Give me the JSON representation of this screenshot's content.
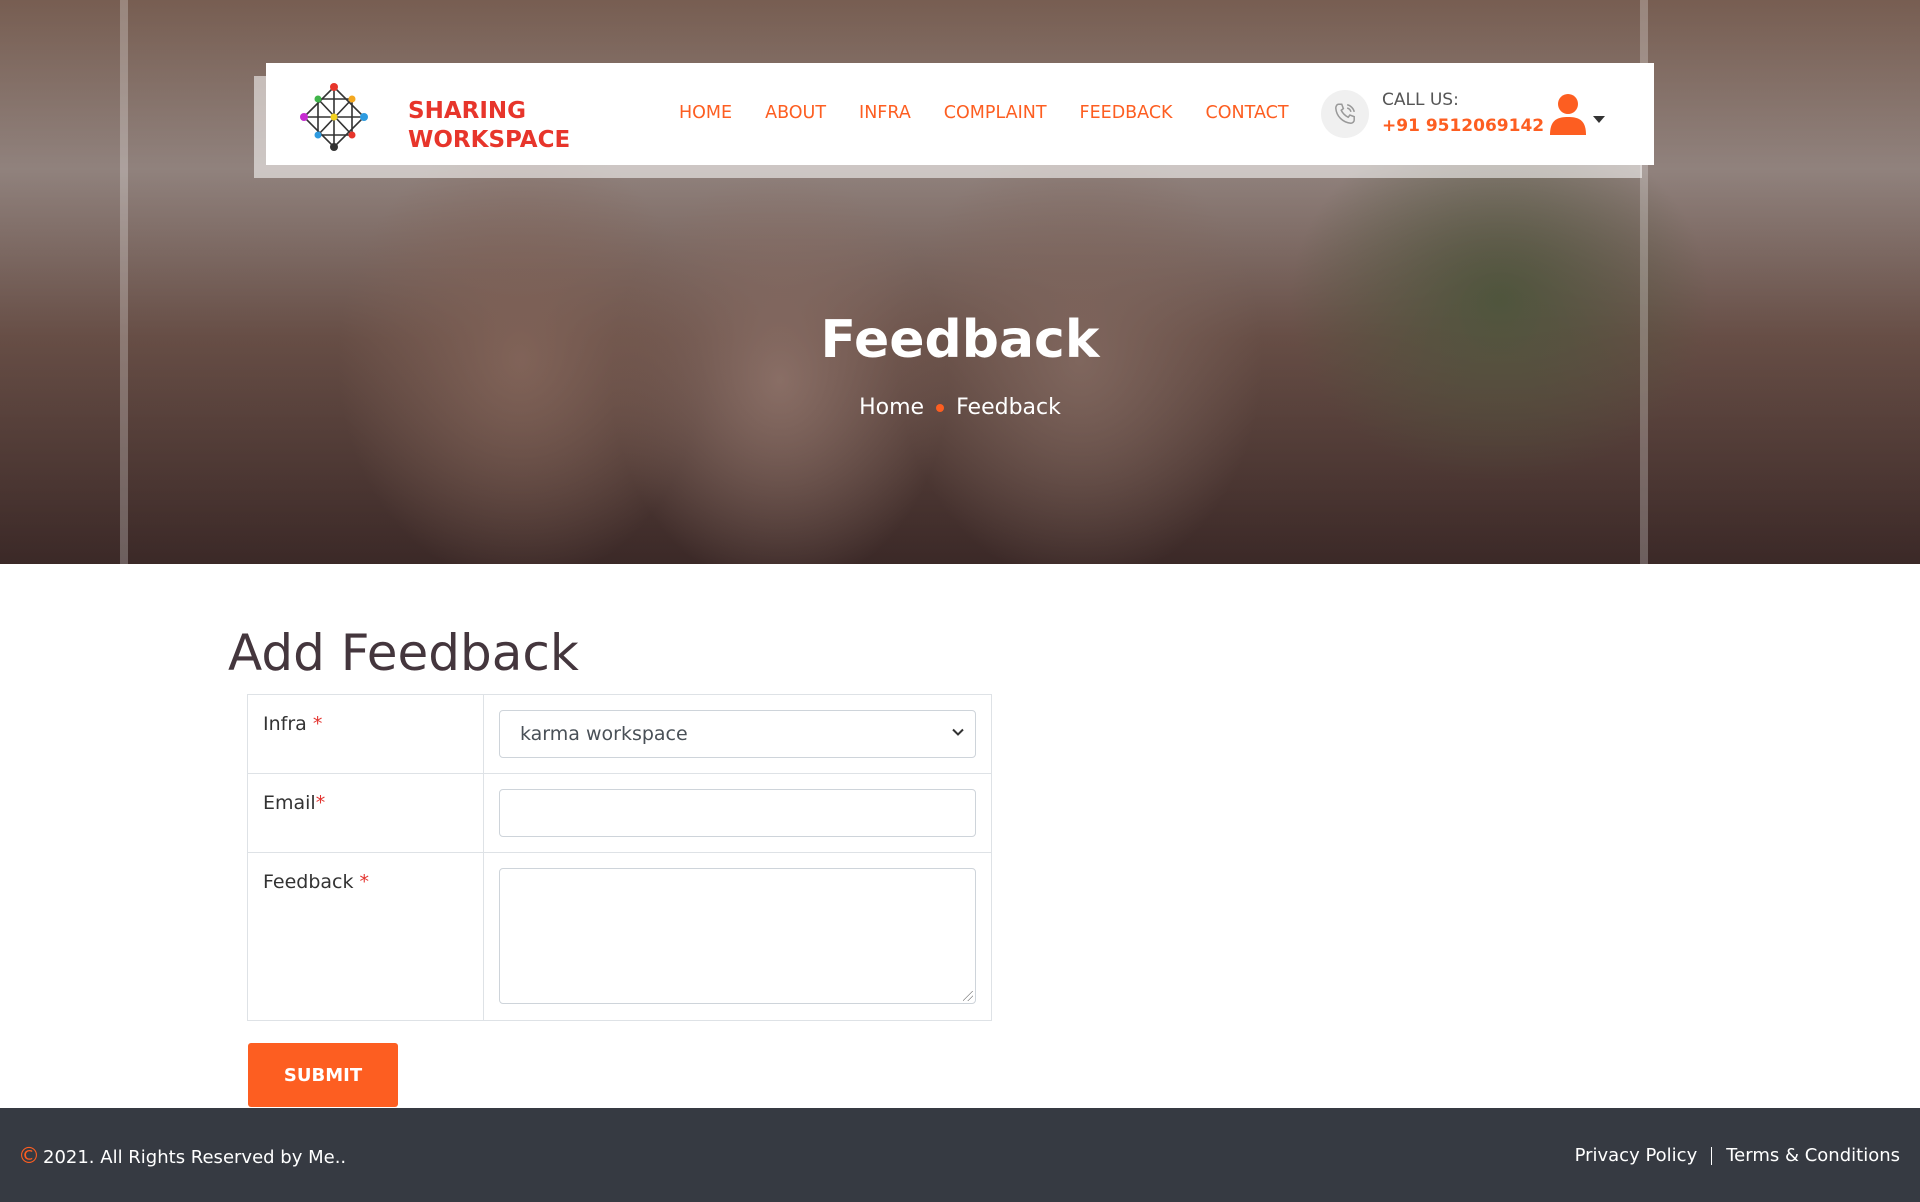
{
  "brand": {
    "name_line1": "SHARING",
    "name_line2": "WORKSPACE",
    "accent_color": "#fd5e21",
    "logo_red": "#e7352b"
  },
  "nav": {
    "items": [
      {
        "label": "HOME"
      },
      {
        "label": "ABOUT"
      },
      {
        "label": "INFRA"
      },
      {
        "label": "COMPLAINT"
      },
      {
        "label": "FEEDBACK"
      },
      {
        "label": "CONTACT"
      }
    ]
  },
  "contact": {
    "label": "CALL US:",
    "number": "+91 9512069142",
    "icon": "phone-icon"
  },
  "user_menu": {
    "icon": "user-icon"
  },
  "hero": {
    "title": "Feedback",
    "breadcrumb": [
      "Home",
      "Feedback"
    ]
  },
  "form": {
    "title": "Add Feedback",
    "fields": {
      "infra": {
        "label": "Infra ",
        "required_mark": "*",
        "selected": "karma workspace"
      },
      "email": {
        "label": "Email",
        "required_mark": "*",
        "value": ""
      },
      "feedback": {
        "label": "Feedback ",
        "required_mark": "*",
        "value": ""
      }
    },
    "submit_label": "SUBMIT"
  },
  "footer": {
    "copyright_symbol": "©",
    "copyright_text": "2021. All Rights Reserved by Me..",
    "links": [
      "Privacy Policy",
      "Terms & Conditions"
    ]
  }
}
